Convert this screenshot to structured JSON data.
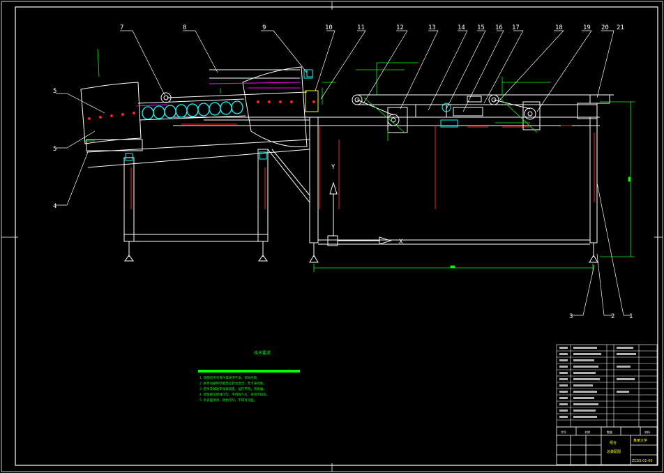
{
  "part_labels": {
    "p1": "1",
    "p2": "2",
    "p3": "3",
    "p4": "4",
    "p5a": "5",
    "p5b": "5",
    "p7": "7",
    "p8": "8",
    "p9": "9",
    "p10": "10",
    "p11": "11",
    "p12": "12",
    "p13": "13",
    "p14": "14",
    "p15": "15",
    "p16": "16",
    "p17": "17",
    "p18": "18",
    "p19": "19",
    "p20": "20",
    "p21": "21"
  },
  "axis_marks": {
    "y": "Y",
    "x": "X"
  },
  "notes": {
    "title": "技术要求",
    "lines": [
      "1. 装配前所有零件需清洗干净，去除毛刺。",
      "2. 各传动部件装配后应转动灵活，无卡滞现象。",
      "3. 链条及输送带张紧适度，运行平稳，无跑偏。",
      "4. 焊接部位焊缝均匀，不得有气孔、夹渣等缺陷。",
      "5. 外表面涂漆，颜色均匀，不得有流挂。"
    ]
  },
  "title_block": {
    "school": "某某大学",
    "drawing_name": "总装配图",
    "code": "ZCSS-01-00",
    "material": "组合",
    "headers": [
      "代号",
      "名称",
      "数量",
      "材料"
    ]
  },
  "colors": {
    "frame": "#ffffff",
    "green": "#00ff00",
    "red": "#ff2020",
    "cyan": "#00ffff",
    "yellow": "#ffff00",
    "magenta": "#ff00ff",
    "dim": "#00ff00"
  }
}
